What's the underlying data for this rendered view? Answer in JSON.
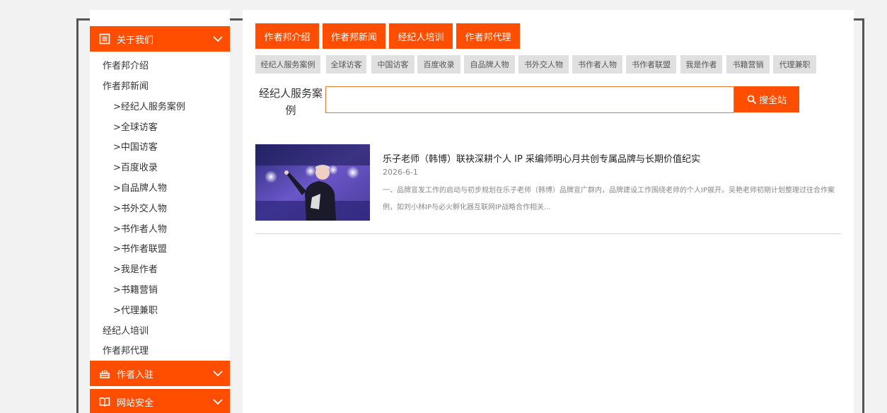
{
  "sidebar": {
    "sections": [
      {
        "label": "关于我们",
        "icon": "list-icon"
      },
      {
        "label": "作者入驻",
        "icon": "cake-icon"
      },
      {
        "label": "网站安全",
        "icon": "book-icon"
      }
    ],
    "items": [
      "作者邦介绍",
      "作者邦新闻",
      ">经纪人服务案例",
      ">全球访客",
      ">中国访客",
      ">百度收录",
      ">自品牌人物",
      ">书外交人物",
      ">书作者人物",
      ">书作者联盟",
      ">我是作者",
      ">书籍营销",
      ">代理兼职",
      "经纪人培训",
      "作者邦代理"
    ]
  },
  "tabs": [
    "作者邦介绍",
    "作者邦新闻",
    "经纪人培训",
    "作者邦代理"
  ],
  "chips": [
    "经纪人服务案例",
    "全球访客",
    "中国访客",
    "百度收录",
    "自品牌人物",
    "书外交人物",
    "书作者人物",
    "书作者联盟",
    "我是作者",
    "书籍营销",
    "代理兼职"
  ],
  "search": {
    "label": "经纪人服务案例",
    "placeholder": "",
    "button": "搜全站"
  },
  "article": {
    "title": "乐子老师（韩博）联袂深耕个人 IP 采编师明心月共创专属品牌与长期价值纪实",
    "date": "2026-6-1",
    "summary": "一、品牌宣发工作的启动与初步规划在乐子老师（韩博）品牌宣广群内，品牌建设工作围绕老师的个人IP展开。吴艳老师初期计划整理过往合作案例，如刘小林IP与必火孵化器互联网IP战略合作相关..."
  },
  "colors": {
    "accent": "#ff4e00",
    "chip_bg": "#e0e0e0",
    "frame": "#555555"
  }
}
